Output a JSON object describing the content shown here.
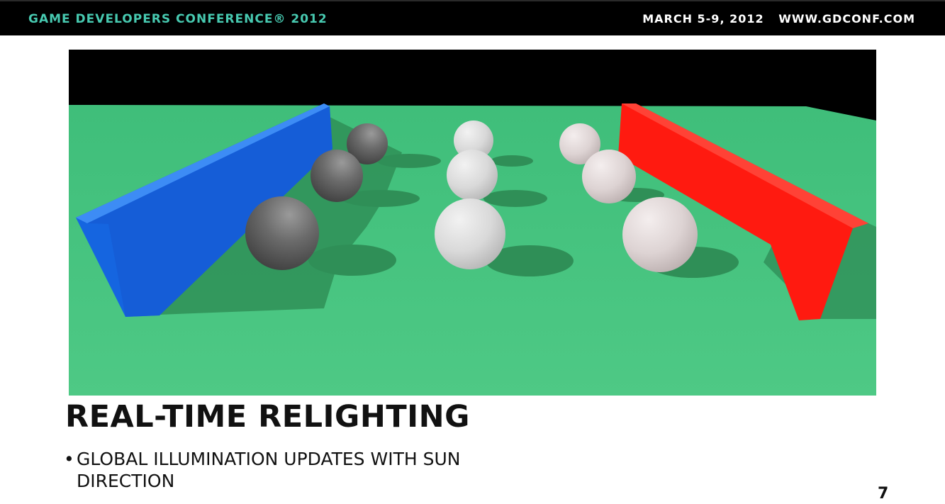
{
  "header": {
    "conference": "GAME DEVELOPERS CONFERENCE® 2012",
    "dates": "MARCH 5-9, 2012",
    "website": "WWW.GDCONF.COM"
  },
  "slide": {
    "title": "REAL-TIME RELIGHTING",
    "bullets": [
      "GLOBAL ILLUMINATION UPDATES WITH SUN DIRECTION"
    ],
    "page_number": "7"
  },
  "scene": {
    "description_colors": {
      "floor": "#46c47f",
      "left_wall": "#1565e0",
      "right_wall": "#ff1a10",
      "sky": "#000000",
      "sphere": "#dcdcdc"
    }
  }
}
